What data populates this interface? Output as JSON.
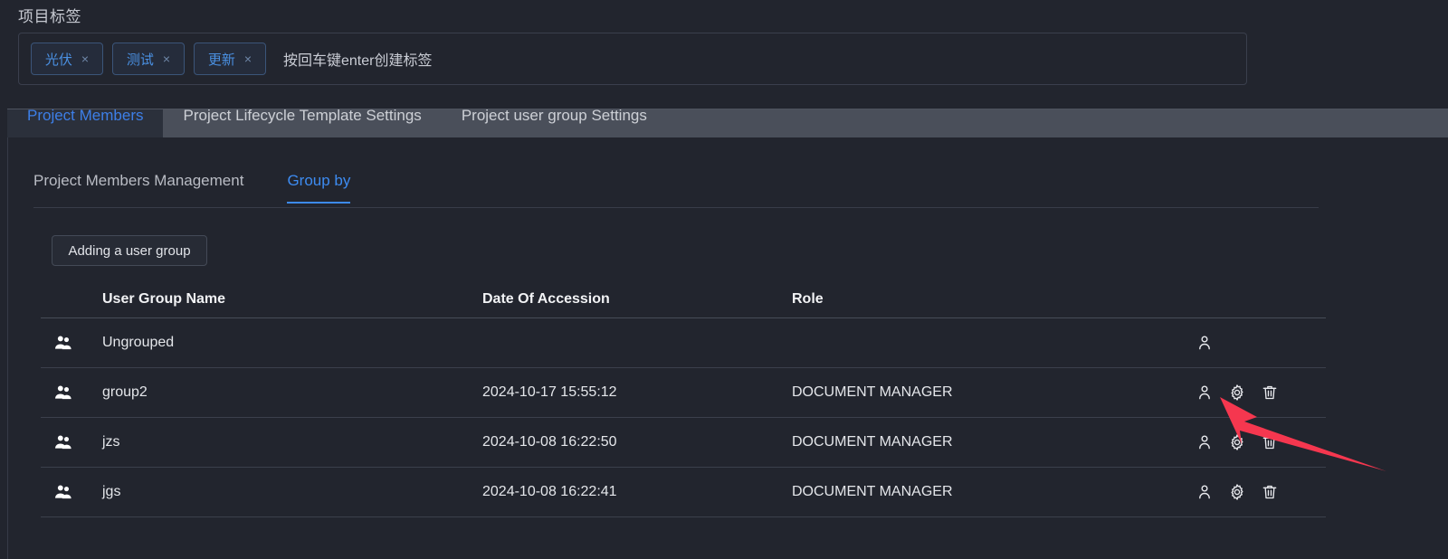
{
  "tag_panel": {
    "label": "项目标签",
    "placeholder": "按回车键enter创建标签",
    "tags": [
      {
        "text": "光伏",
        "close": "×"
      },
      {
        "text": "测试",
        "close": "×"
      },
      {
        "text": "更新",
        "close": "×"
      }
    ]
  },
  "tabs": [
    {
      "label": "Project Members",
      "active": true
    },
    {
      "label": "Project Lifecycle Template Settings",
      "active": false
    },
    {
      "label": "Project user group Settings",
      "active": false
    }
  ],
  "subtabs": [
    {
      "label": "Project Members Management",
      "active": false
    },
    {
      "label": "Group by",
      "active": true
    }
  ],
  "toolbar": {
    "add_user_group_label": "Adding a user group"
  },
  "table": {
    "columns": [
      "User Group Name",
      "Date Of Accession",
      "Role"
    ],
    "rows": [
      {
        "icon": "user-group-icon",
        "name": "Ungrouped",
        "date": "",
        "role": "",
        "actions": [
          "manage-members-icon"
        ]
      },
      {
        "icon": "user-group-icon",
        "name": "group2",
        "date": "2024-10-17 15:55:12",
        "role": "DOCUMENT MANAGER",
        "actions": [
          "manage-members-icon",
          "settings-gear-icon",
          "delete-trash-icon"
        ]
      },
      {
        "icon": "user-group-icon",
        "name": "jzs",
        "date": "2024-10-08 16:22:50",
        "role": "DOCUMENT MANAGER",
        "actions": [
          "manage-members-icon",
          "settings-gear-icon",
          "delete-trash-icon"
        ]
      },
      {
        "icon": "user-group-icon",
        "name": "jgs",
        "date": "2024-10-08 16:22:41",
        "role": "DOCUMENT MANAGER",
        "actions": [
          "manage-members-icon",
          "settings-gear-icon",
          "delete-trash-icon"
        ]
      }
    ]
  },
  "annotation": {
    "type": "arrow",
    "color": "#f5374f",
    "points_at": "settings-gear-icon of group2 row"
  },
  "colors": {
    "page_background": "#22252e",
    "tabstrip_background": "#4a4f5a",
    "active_tab_background": "#2b303b",
    "accent_blue": "#3d8bf0",
    "tag_blue": "#4a90e2",
    "annotation_red": "#f5374f"
  }
}
